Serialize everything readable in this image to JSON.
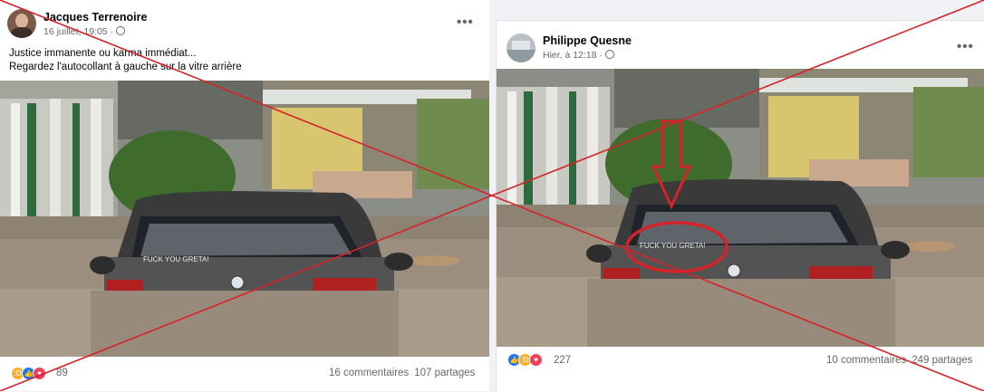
{
  "left_post": {
    "author": "Jacques Terrenoire",
    "timestamp": "16 juillet, 19:05 ·",
    "caption_line1": "Justice immanente ou karma immédiat...",
    "caption_line2": "Regardez l'autocollant à gauche sur la vitre arrière",
    "more_label": "•••",
    "reaction_count": "89",
    "comments": "16 commentaires",
    "shares": "107 partages",
    "sticker_text": "FUCK YOU GRETA!"
  },
  "right_post": {
    "author": "Philippe Quesne",
    "timestamp": "Hier, à 12:18 ·",
    "more_label": "•••",
    "reaction_count": "227",
    "comments": "10 commentaires",
    "shares": "249 partages",
    "sticker_text": "FUCK YOU GRETA!"
  },
  "colors": {
    "cross": "#d6232a",
    "like": "#1877f2",
    "love": "#f33e58",
    "haha": "#f7b125"
  },
  "icons": {
    "like": "thumbs-up-icon",
    "love": "heart-icon",
    "haha": "laughing-face-icon",
    "globe": "globe-icon"
  }
}
